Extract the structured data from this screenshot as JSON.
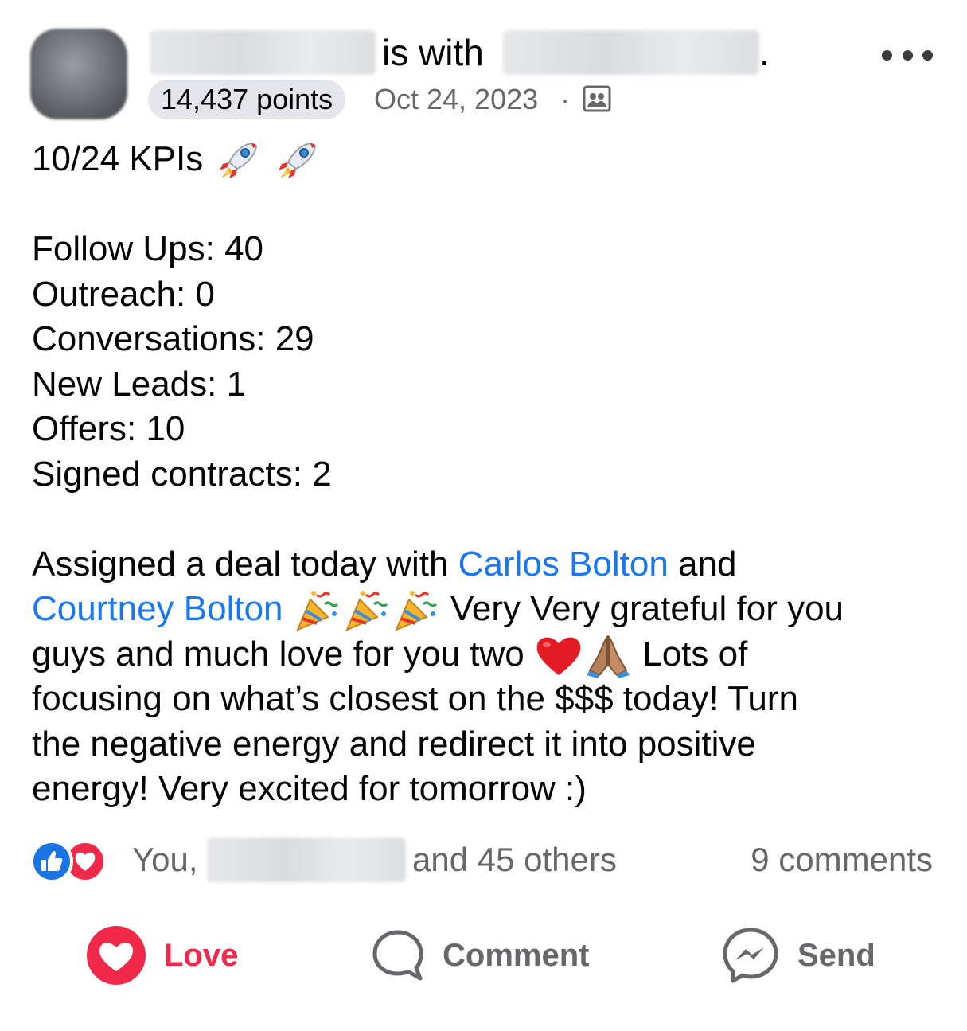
{
  "post": {
    "with_text": "is with",
    "period": ".",
    "points": "14,437 points",
    "date": "Oct 24, 2023",
    "separator": "·",
    "audience_icon": "group-audience-icon"
  },
  "body": {
    "line1": "10/24 KPIs",
    "stats": [
      "Follow Ups: 40",
      "Outreach: 0",
      "Conversations: 29",
      "New Leads: 1",
      "Offers: 10",
      "Signed contracts: 2"
    ],
    "p1": "Assigned a deal today with ",
    "link1": "Carlos Bolton",
    "p2": " and",
    "link2": "Courtney Bolton",
    "p3": " Very Very grateful for you",
    "p4": "guys and much love for you two ",
    "p5": " Lots of",
    "p6": "focusing on what’s closest on the $$$ today! Turn",
    "p7": "the negative energy and redirect it into positive",
    "p8": "energy! Very excited for tomorrow :)"
  },
  "reactions": {
    "you": "You,",
    "others": "and 45 others",
    "comments": "9 comments"
  },
  "actions": {
    "love": "Love",
    "comment": "Comment",
    "send": "Send"
  },
  "colors": {
    "link": "#1877f2",
    "love": "#f02849",
    "like": "#1b74e4",
    "secondary_text": "#65676b"
  }
}
